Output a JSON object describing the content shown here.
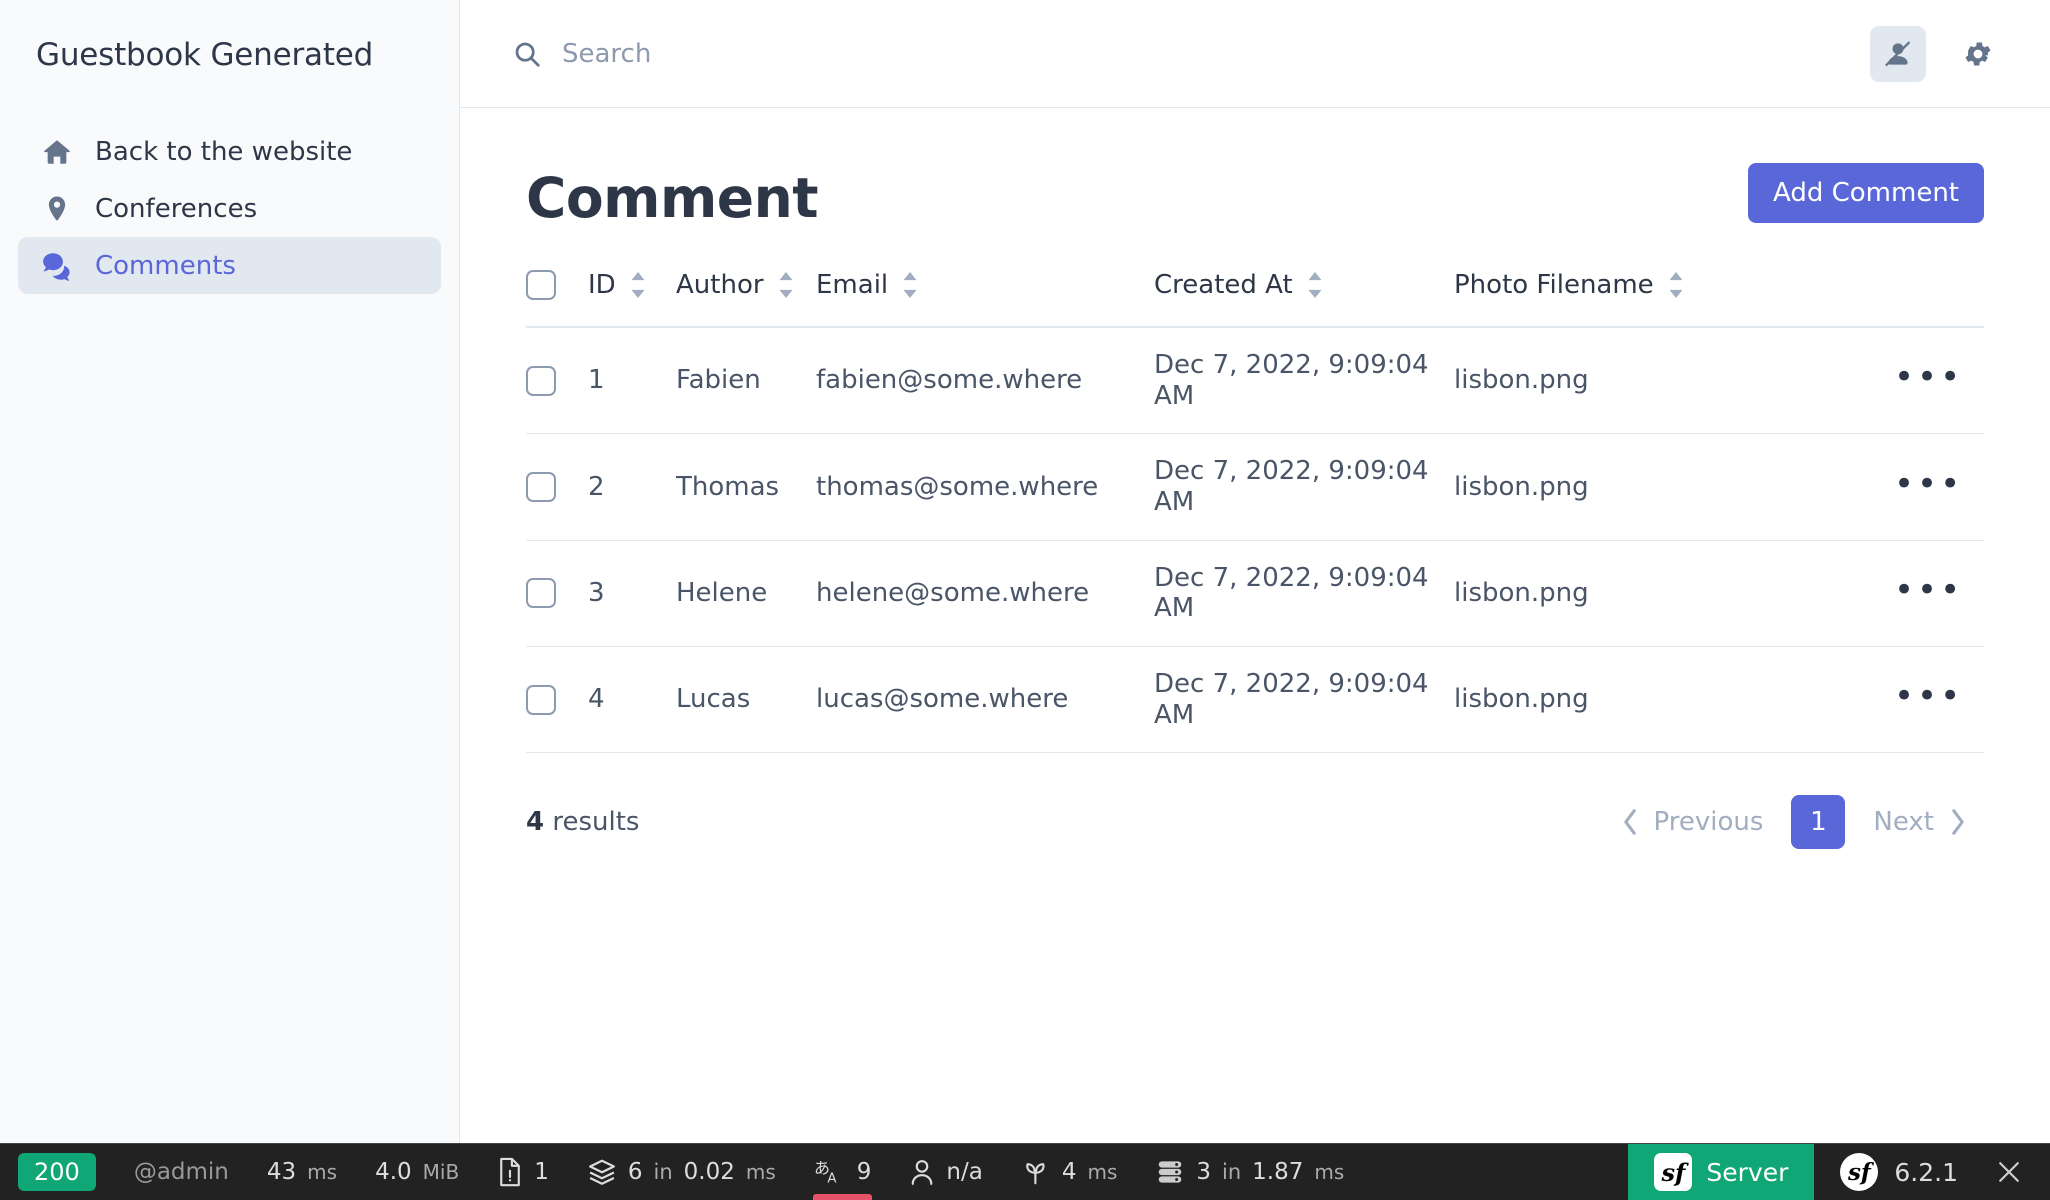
{
  "sidebar": {
    "brand": "Guestbook Generated",
    "items": [
      {
        "label": "Back to the website",
        "icon": "home-icon",
        "active": false
      },
      {
        "label": "Conferences",
        "icon": "map-pin-icon",
        "active": false
      },
      {
        "label": "Comments",
        "icon": "comments-icon",
        "active": true
      }
    ]
  },
  "topbar": {
    "search_placeholder": "Search",
    "search_value": "",
    "impersonate_icon": "user-slash-icon",
    "settings_icon": "gear-icon"
  },
  "page": {
    "title": "Comment",
    "add_button": "Add Comment"
  },
  "table": {
    "columns": [
      {
        "label": "ID",
        "sortable": true
      },
      {
        "label": "Author",
        "sortable": true
      },
      {
        "label": "Email",
        "sortable": true
      },
      {
        "label": "Created At",
        "sortable": true
      },
      {
        "label": "Photo Filename",
        "sortable": true
      }
    ],
    "rows": [
      {
        "id": "1",
        "author": "Fabien",
        "email": "fabien@some.where",
        "created_at": "Dec 7, 2022, 9:09:04 AM",
        "photo": "lisbon.png"
      },
      {
        "id": "2",
        "author": "Thomas",
        "email": "thomas@some.where",
        "created_at": "Dec 7, 2022, 9:09:04 AM",
        "photo": "lisbon.png"
      },
      {
        "id": "3",
        "author": "Helene",
        "email": "helene@some.where",
        "created_at": "Dec 7, 2022, 9:09:04 AM",
        "photo": "lisbon.png"
      },
      {
        "id": "4",
        "author": "Lucas",
        "email": "lucas@some.where",
        "created_at": "Dec 7, 2022, 9:09:04 AM",
        "photo": "lisbon.png"
      }
    ],
    "row_action_label": "•••"
  },
  "footer": {
    "results_count": "4",
    "results_label": "results",
    "previous": "Previous",
    "next": "Next",
    "current_page": "1"
  },
  "debug_toolbar": {
    "status_code": "200",
    "user": "@admin",
    "time_value": "43",
    "time_unit": "ms",
    "memory_value": "4.0",
    "memory_unit": "MiB",
    "logs_count": "1",
    "cache_count": "6",
    "cache_in": "in",
    "cache_time": "0.02",
    "cache_unit": "ms",
    "translation_count": "9",
    "security_user": "n/a",
    "twig_time": "4",
    "twig_unit": "ms",
    "db_count": "3",
    "db_in": "in",
    "db_time": "1.87",
    "db_unit": "ms",
    "server_label": "Server",
    "version": "6.2.1",
    "logo_text": "sf",
    "close_label": "×"
  },
  "colors": {
    "accent": "#5a67d8",
    "sidebar_bg": "#f8fafc",
    "active_bg": "#e2e8f0",
    "status_green": "#10a675",
    "toolbar_bg": "#222222",
    "alert_red": "#e5526a"
  }
}
